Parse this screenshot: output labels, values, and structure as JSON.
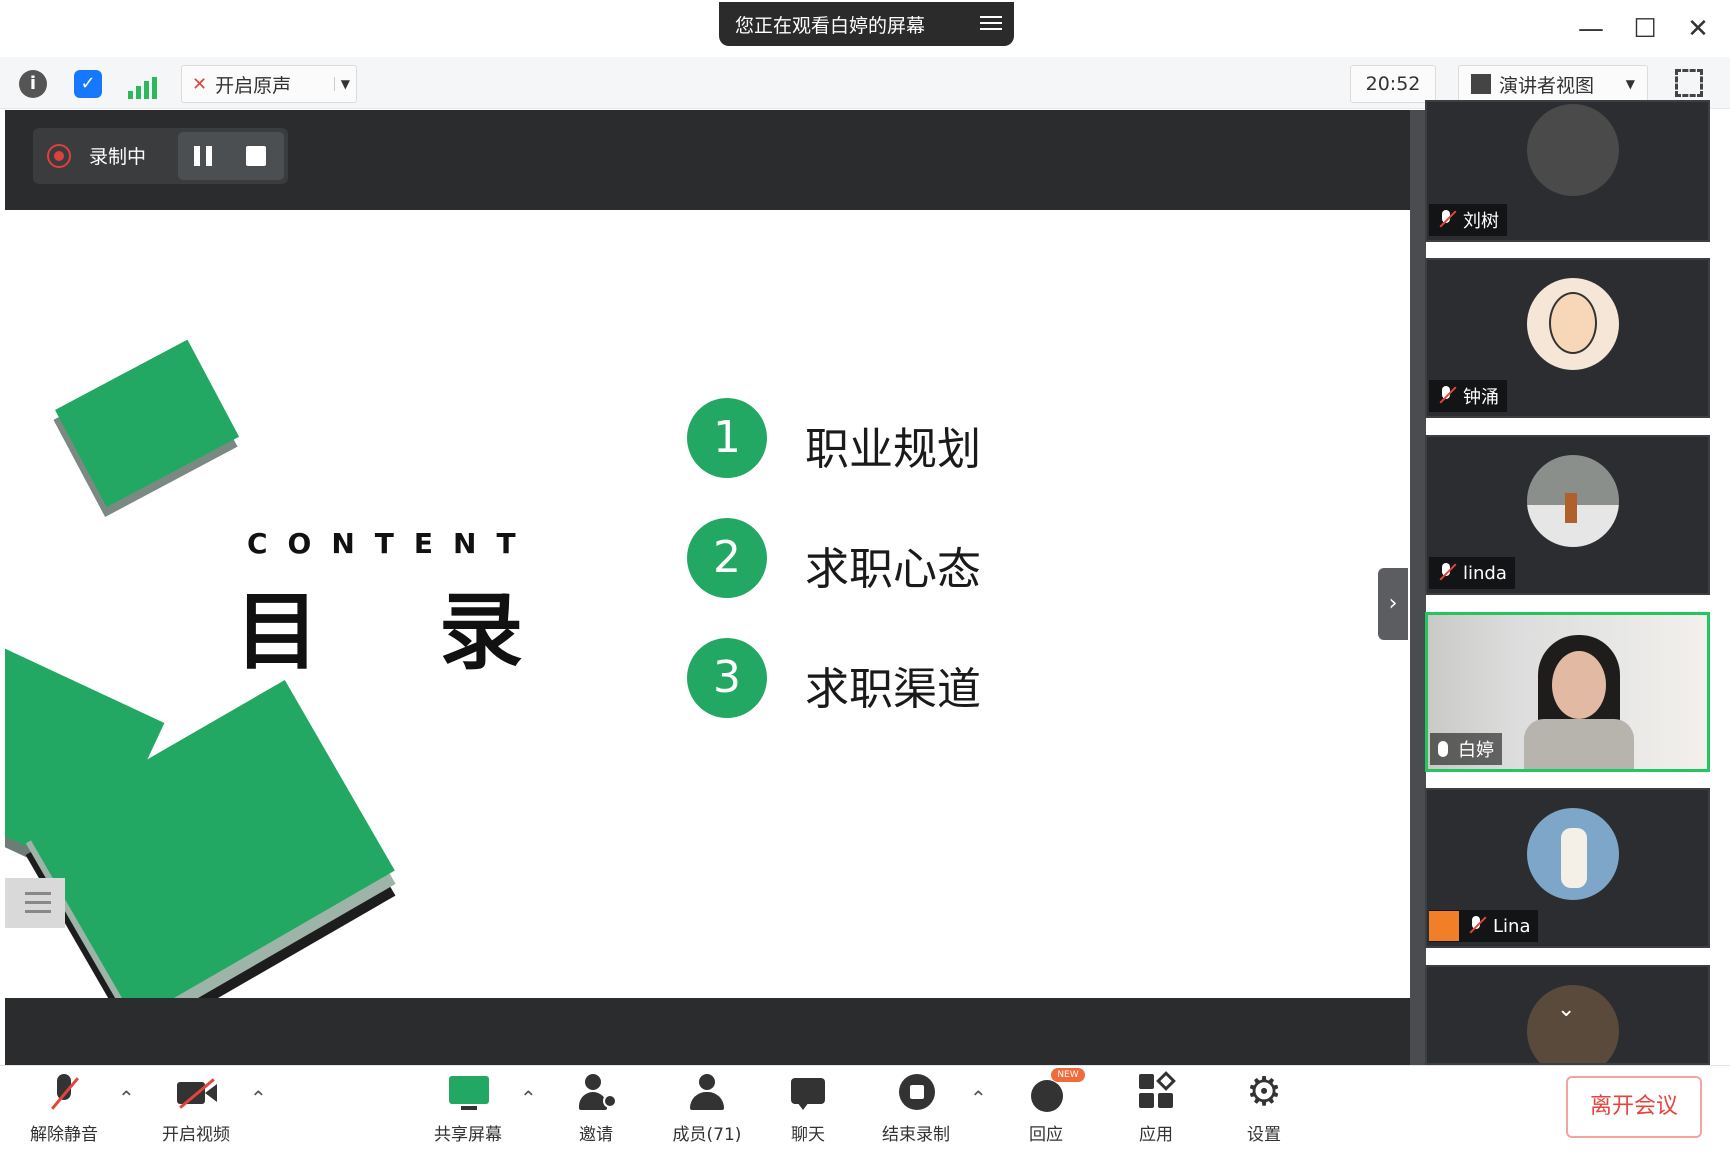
{
  "window": {
    "share_banner": "您正在观看白婷的屏幕",
    "minimize_icon": "minimize-icon",
    "maximize_icon": "maximize-icon",
    "close_icon": "close-icon"
  },
  "toolbar": {
    "original_sound": "开启原声",
    "time": "20:52",
    "view_mode": "演讲者视图"
  },
  "recording": {
    "status": "录制中"
  },
  "slide": {
    "content_word": "CONTENT",
    "title": "目录",
    "items": [
      {
        "num": "1",
        "text": "职业规划"
      },
      {
        "num": "2",
        "text": "求职心态"
      },
      {
        "num": "3",
        "text": "求职渠道"
      }
    ],
    "accent_color": "#22a862"
  },
  "participants": [
    {
      "name": "刘树",
      "muted": true
    },
    {
      "name": "钟涌",
      "muted": true
    },
    {
      "name": "linda",
      "muted": true
    },
    {
      "name": "白婷",
      "muted": false,
      "active": true
    },
    {
      "name": "Lina",
      "muted": true,
      "host": true
    },
    {
      "name": "",
      "muted": true
    }
  ],
  "bottom_bar": {
    "unmute": "解除静音",
    "start_video": "开启视频",
    "share_screen": "共享屏幕",
    "invite": "邀请",
    "members": "成员(71)",
    "chat": "聊天",
    "stop_recording": "结束录制",
    "reactions": "回应",
    "reactions_badge": "NEW",
    "apps": "应用",
    "settings": "设置",
    "leave": "离开会议"
  }
}
